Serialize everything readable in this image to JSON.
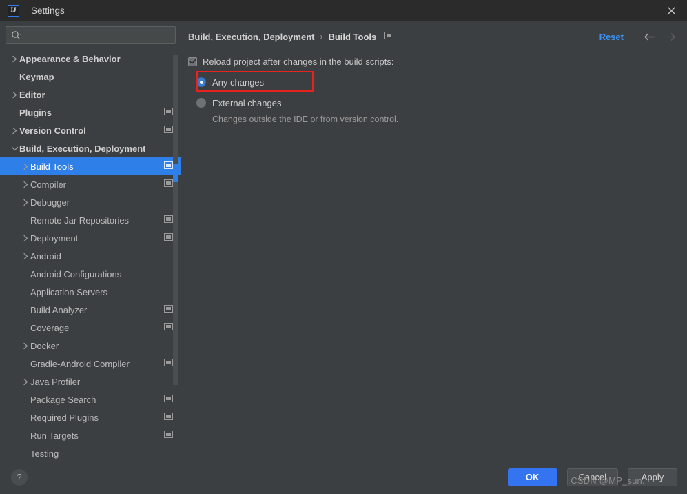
{
  "window": {
    "title": "Settings",
    "logo_text": "IJ",
    "close_label": "×"
  },
  "search": {
    "placeholder": "",
    "value": "",
    "icon": "search-icon"
  },
  "sidebar": {
    "items": [
      {
        "label": "Appearance & Behavior",
        "level": 0,
        "arrow": "collapsed",
        "project_icon": false,
        "selected": false
      },
      {
        "label": "Keymap",
        "level": 0,
        "arrow": "none",
        "project_icon": false,
        "selected": false
      },
      {
        "label": "Editor",
        "level": 0,
        "arrow": "collapsed",
        "project_icon": false,
        "selected": false
      },
      {
        "label": "Plugins",
        "level": 0,
        "arrow": "none",
        "project_icon": true,
        "selected": false
      },
      {
        "label": "Version Control",
        "level": 0,
        "arrow": "collapsed",
        "project_icon": true,
        "selected": false
      },
      {
        "label": "Build, Execution, Deployment",
        "level": 0,
        "arrow": "expanded",
        "project_icon": false,
        "selected": false
      },
      {
        "label": "Build Tools",
        "level": 1,
        "arrow": "collapsed",
        "project_icon": true,
        "selected": true
      },
      {
        "label": "Compiler",
        "level": 1,
        "arrow": "collapsed",
        "project_icon": true,
        "selected": false
      },
      {
        "label": "Debugger",
        "level": 1,
        "arrow": "collapsed",
        "project_icon": false,
        "selected": false
      },
      {
        "label": "Remote Jar Repositories",
        "level": 1,
        "arrow": "none",
        "project_icon": true,
        "selected": false
      },
      {
        "label": "Deployment",
        "level": 1,
        "arrow": "collapsed",
        "project_icon": true,
        "selected": false
      },
      {
        "label": "Android",
        "level": 1,
        "arrow": "collapsed",
        "project_icon": false,
        "selected": false
      },
      {
        "label": "Android Configurations",
        "level": 1,
        "arrow": "none",
        "project_icon": false,
        "selected": false
      },
      {
        "label": "Application Servers",
        "level": 1,
        "arrow": "none",
        "project_icon": false,
        "selected": false
      },
      {
        "label": "Build Analyzer",
        "level": 1,
        "arrow": "none",
        "project_icon": true,
        "selected": false
      },
      {
        "label": "Coverage",
        "level": 1,
        "arrow": "none",
        "project_icon": true,
        "selected": false
      },
      {
        "label": "Docker",
        "level": 1,
        "arrow": "collapsed",
        "project_icon": false,
        "selected": false
      },
      {
        "label": "Gradle-Android Compiler",
        "level": 1,
        "arrow": "none",
        "project_icon": true,
        "selected": false
      },
      {
        "label": "Java Profiler",
        "level": 1,
        "arrow": "collapsed",
        "project_icon": false,
        "selected": false
      },
      {
        "label": "Package Search",
        "level": 1,
        "arrow": "none",
        "project_icon": true,
        "selected": false
      },
      {
        "label": "Required Plugins",
        "level": 1,
        "arrow": "none",
        "project_icon": true,
        "selected": false
      },
      {
        "label": "Run Targets",
        "level": 1,
        "arrow": "none",
        "project_icon": true,
        "selected": false
      },
      {
        "label": "Testing",
        "level": 1,
        "arrow": "none",
        "project_icon": false,
        "selected": false
      }
    ]
  },
  "header": {
    "breadcrumb_parent": "Build, Execution, Deployment",
    "breadcrumb_separator": "›",
    "breadcrumb_current": "Build Tools",
    "project_icon": "project-settings-icon",
    "reset_label": "Reset",
    "back_icon": "arrow-left-icon",
    "forward_icon": "arrow-right-icon"
  },
  "main": {
    "reload_checkbox_label": "Reload project after changes in the build scripts:",
    "reload_checkbox_checked": true,
    "options": [
      {
        "label": "Any changes",
        "checked": true,
        "hint": ""
      },
      {
        "label": "External changes",
        "checked": false,
        "hint": "Changes outside the IDE or from version control."
      }
    ]
  },
  "footer": {
    "help_label": "?",
    "ok_label": "OK",
    "cancel_label": "Cancel",
    "apply_label": "Apply"
  },
  "watermark": {
    "text": "CSDN @MP_sun."
  },
  "colors": {
    "accent_blue": "#3574f0",
    "selection_blue": "#2f7fe8",
    "link_blue": "#3d93f5",
    "highlight_red": "#e8231f",
    "panel_bg": "#3c3f41",
    "titlebar_bg": "#2b2b2b"
  }
}
